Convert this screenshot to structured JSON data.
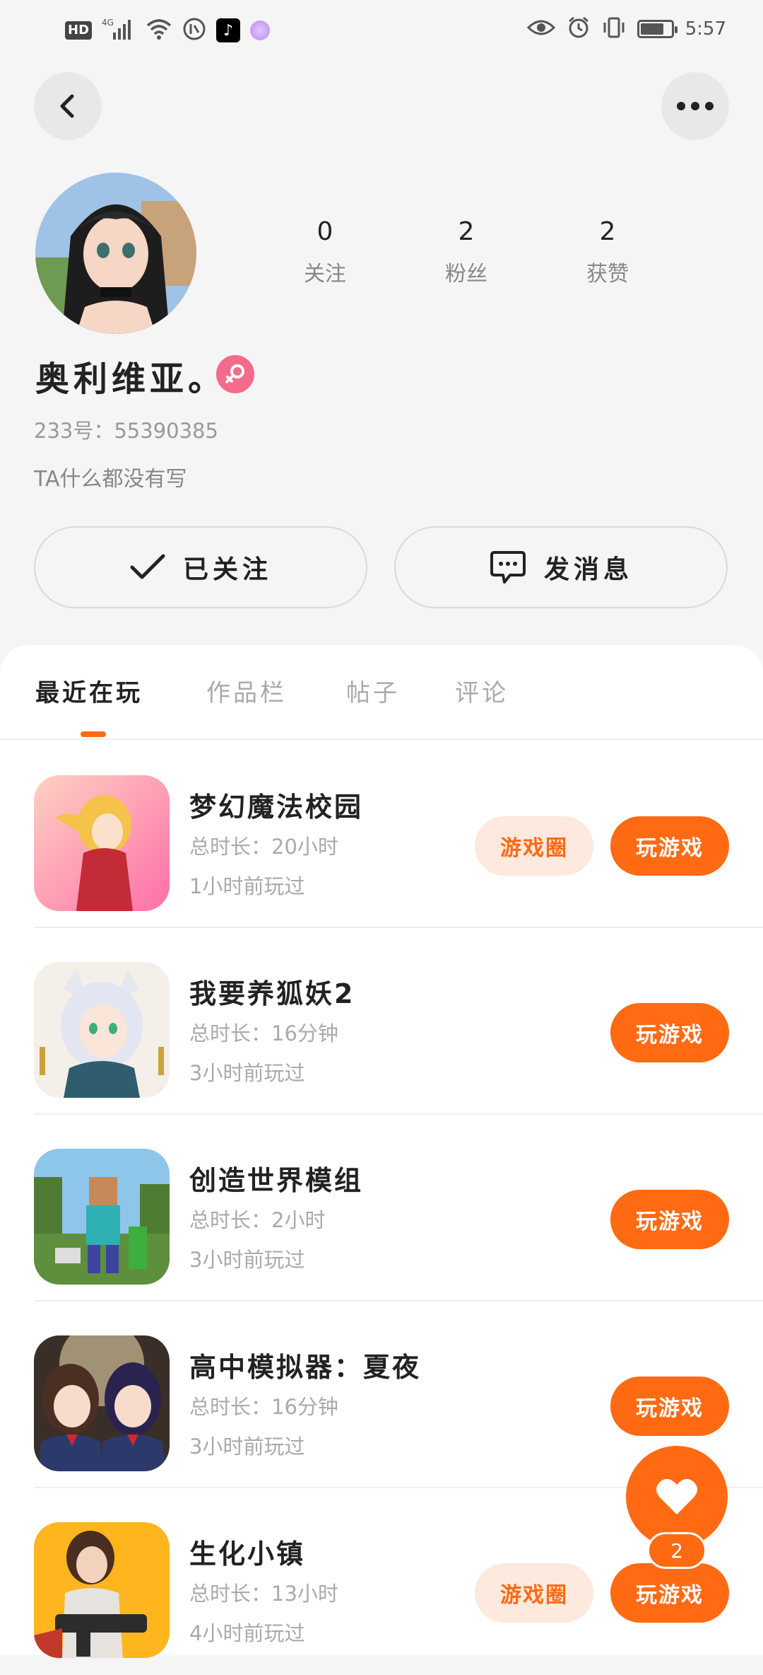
{
  "status_bar": {
    "hd_badge": "HD",
    "network": "4G",
    "time": "5:57",
    "battery_level": 0.8
  },
  "nav": {
    "back_icon": "chevron-left-icon",
    "more_icon": "more-horizontal-icon"
  },
  "profile": {
    "stats": [
      {
        "value": "0",
        "label": "关注"
      },
      {
        "value": "2",
        "label": "粉丝"
      },
      {
        "value": "2",
        "label": "获赞"
      }
    ],
    "username": "奥利维亚。",
    "gender_icon": "female-icon",
    "uid": "233号：55390385",
    "bio": "TA什么都没有写"
  },
  "actions": {
    "follow_label": "已关注",
    "message_label": "发消息"
  },
  "tabs": [
    {
      "label": "最近在玩",
      "active": true
    },
    {
      "label": "作品栏",
      "active": false
    },
    {
      "label": "帖子",
      "active": false
    },
    {
      "label": "评论",
      "active": false
    }
  ],
  "games": [
    {
      "title": "梦幻魔法校园",
      "duration": "总时长：20小时",
      "last_played": "1小时前玩过",
      "has_circle": true,
      "circle_label": "游戏圈",
      "play_label": "玩游戏"
    },
    {
      "title": "我要养狐妖2",
      "duration": "总时长：16分钟",
      "last_played": "3小时前玩过",
      "has_circle": false,
      "circle_label": "",
      "play_label": "玩游戏"
    },
    {
      "title": "创造世界模组",
      "duration": "总时长：2小时",
      "last_played": "3小时前玩过",
      "has_circle": false,
      "circle_label": "",
      "play_label": "玩游戏"
    },
    {
      "title": "高中模拟器：夏夜",
      "duration": "总时长：16分钟",
      "last_played": "3小时前玩过",
      "has_circle": false,
      "circle_label": "",
      "play_label": "玩游戏"
    },
    {
      "title": "生化小镇",
      "duration": "总时长：13小时",
      "last_played": "4小时前玩过",
      "has_circle": true,
      "circle_label": "游戏圈",
      "play_label": "玩游戏"
    }
  ],
  "fab": {
    "icon": "heart-icon",
    "count": "2"
  },
  "colors": {
    "accent": "#ff6a13",
    "accent_light": "#fde9dd",
    "gender": "#f36b8a"
  }
}
